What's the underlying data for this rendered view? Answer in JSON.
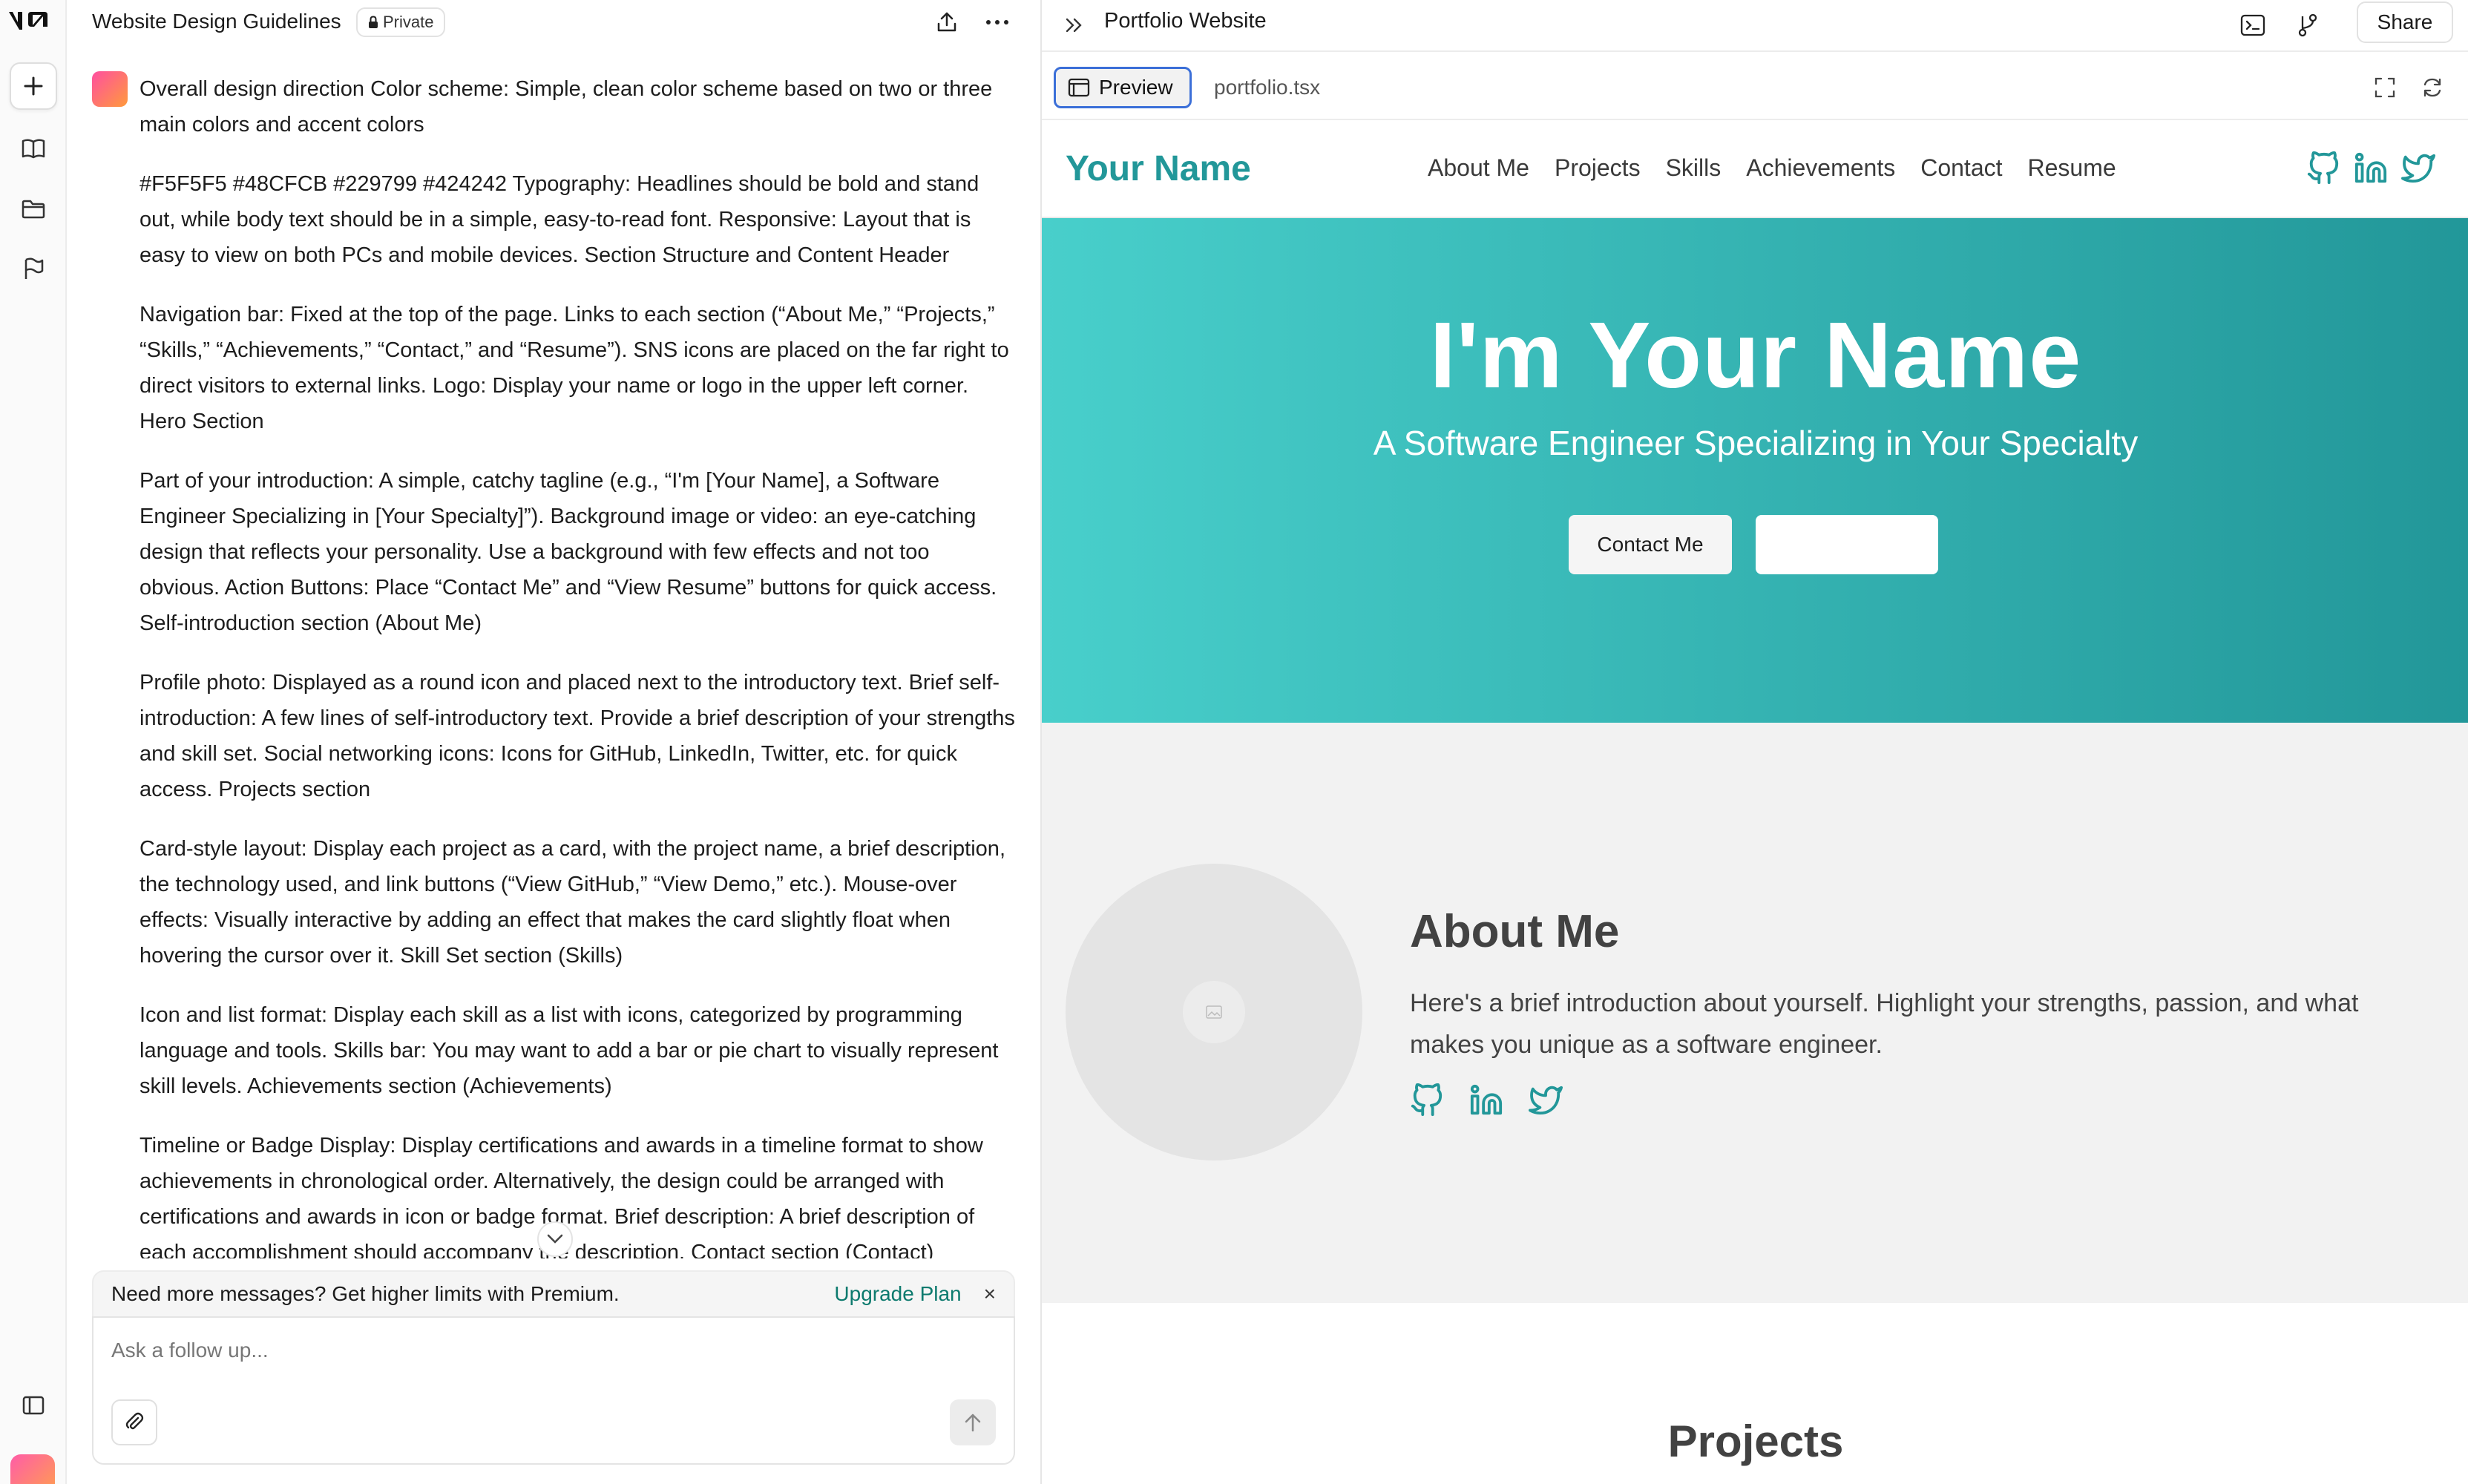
{
  "chat": {
    "title": "Website Design Guidelines",
    "privacy": "Private",
    "messages": [
      "Overall design direction Color scheme: Simple, clean color scheme based on two or three main colors and accent colors",
      "#F5F5F5 #48CFCB #229799 #424242 Typography: Headlines should be bold and stand out, while body text should be in a simple, easy-to-read font. Responsive: Layout that is easy to view on both PCs and mobile devices. Section Structure and Content Header",
      "Navigation bar: Fixed at the top of the page. Links to each section (“About Me,” “Projects,” “Skills,” “Achievements,” “Contact,” and “Resume”). SNS icons are placed on the far right to direct visitors to external links. Logo: Display your name or logo in the upper left corner. Hero Section",
      "Part of your introduction: A simple, catchy tagline (e.g., “I'm [Your Name], a Software Engineer Specializing in [Your Specialty]”). Background image or video: an eye-catching design that reflects your personality. Use a background with few effects and not too obvious. Action Buttons: Place “Contact Me” and “View Resume” buttons for quick access. Self-introduction section (About Me)",
      "Profile photo: Displayed as a round icon and placed next to the introductory text. Brief self-introduction: A few lines of self-introductory text. Provide a brief description of your strengths and skill set. Social networking icons: Icons for GitHub, LinkedIn, Twitter, etc. for quick access. Projects section",
      "Card-style layout: Display each project as a card, with the project name, a brief description, the technology used, and link buttons (“View GitHub,” “View Demo,” etc.). Mouse-over effects: Visually interactive by adding an effect that makes the card slightly float when hovering the cursor over it. Skill Set section (Skills)",
      "Icon and list format: Display each skill as a list with icons, categorized by programming language and tools. Skills bar: You may want to add a bar or pie chart to visually represent skill levels. Achievements section (Achievements)",
      "Timeline or Badge Display: Display certifications and awards in a timeline format to show achievements in chronological order. Alternatively, the design could be arranged with certifications and awards in icon or badge format. Brief description: A brief description of each accomplishment should accompany the description. Contact section (Contact)"
    ],
    "premium": {
      "text": "Need more messages? Get higher limits with Premium.",
      "upgrade": "Upgrade Plan",
      "close": "×"
    },
    "composer": {
      "placeholder": "Ask a follow up..."
    }
  },
  "preview": {
    "title": "Portfolio Website",
    "share": "Share",
    "tabs": {
      "preview": "Preview",
      "file": "portfolio.tsx"
    }
  },
  "site": {
    "logo": "Your Name",
    "nav": [
      "About Me",
      "Projects",
      "Skills",
      "Achievements",
      "Contact",
      "Resume"
    ],
    "hero": {
      "heading": "I'm Your Name",
      "tagline": "A Software Engineer Specializing in Your Specialty",
      "contact_button": "Contact Me",
      "resume_button": ""
    },
    "about": {
      "title": "About Me",
      "text": "Here's a brief introduction about yourself. Highlight your strengths, passion, and what makes you unique as a software engineer."
    },
    "projects": {
      "title": "Projects"
    },
    "colors": {
      "background": "#F5F5F5",
      "accent_light": "#48CFCB",
      "accent": "#229799",
      "text_dark": "#424242"
    },
    "social_icons": [
      "github-icon",
      "linkedin-icon",
      "twitter-icon"
    ]
  }
}
